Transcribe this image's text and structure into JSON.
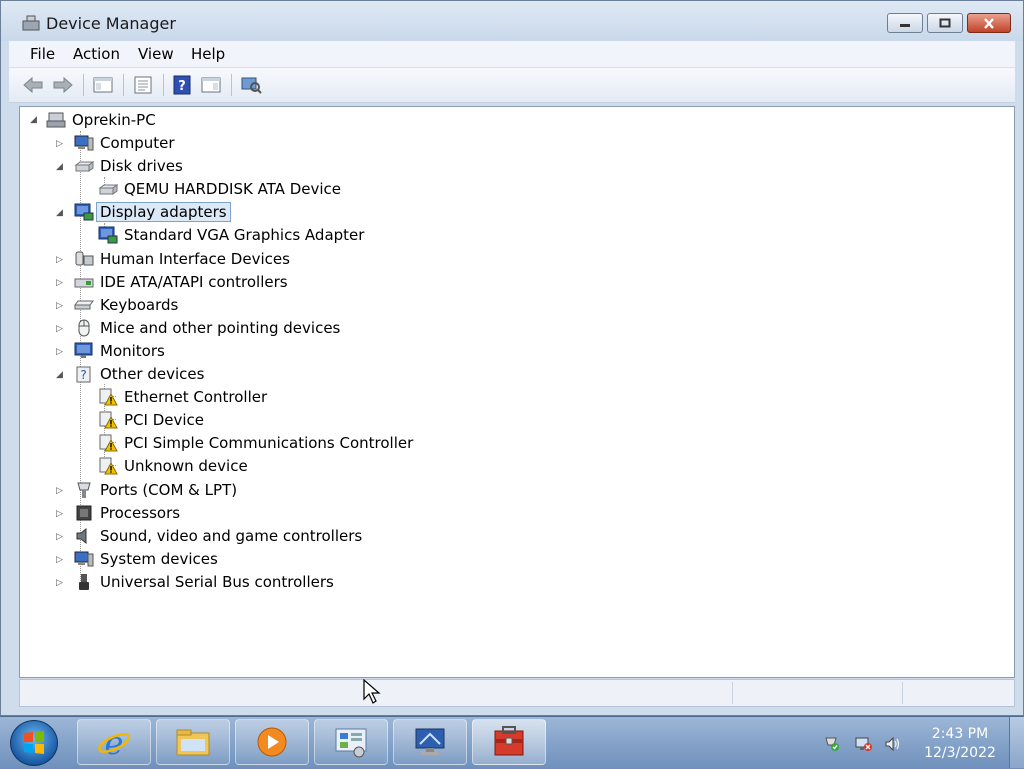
{
  "window": {
    "title": "Device Manager"
  },
  "menu": [
    "File",
    "Action",
    "View",
    "Help"
  ],
  "tree": {
    "root": "Oprekin-PC",
    "items": [
      {
        "label": "Computer",
        "icon": "computer-icon",
        "expander": "collapsed"
      },
      {
        "label": "Disk drives",
        "icon": "disk-drive-icon",
        "expander": "expanded"
      },
      {
        "label": "QEMU HARDDISK ATA Device",
        "icon": "disk-drive-icon",
        "child": true
      },
      {
        "label": "Display adapters",
        "icon": "display-adapter-icon",
        "expander": "expanded",
        "selected": true
      },
      {
        "label": "Standard VGA Graphics Adapter",
        "icon": "display-adapter-icon",
        "child": true
      },
      {
        "label": "Human Interface Devices",
        "icon": "hid-icon",
        "expander": "collapsed"
      },
      {
        "label": "IDE ATA/ATAPI controllers",
        "icon": "ide-controller-icon",
        "expander": "collapsed"
      },
      {
        "label": "Keyboards",
        "icon": "keyboard-icon",
        "expander": "collapsed"
      },
      {
        "label": "Mice and other pointing devices",
        "icon": "mouse-icon",
        "expander": "collapsed"
      },
      {
        "label": "Monitors",
        "icon": "monitor-icon",
        "expander": "collapsed"
      },
      {
        "label": "Other devices",
        "icon": "unknown-device-icon",
        "expander": "expanded"
      },
      {
        "label": "Ethernet Controller",
        "icon": "warning-device-icon",
        "child": true
      },
      {
        "label": "PCI Device",
        "icon": "warning-device-icon",
        "child": true
      },
      {
        "label": "PCI Simple Communications Controller",
        "icon": "warning-device-icon",
        "child": true
      },
      {
        "label": "Unknown device",
        "icon": "warning-device-icon",
        "child": true
      },
      {
        "label": "Ports (COM & LPT)",
        "icon": "port-icon",
        "expander": "collapsed"
      },
      {
        "label": "Processors",
        "icon": "processor-icon",
        "expander": "collapsed"
      },
      {
        "label": "Sound, video and game controllers",
        "icon": "speaker-icon",
        "expander": "collapsed"
      },
      {
        "label": "System devices",
        "icon": "computer-icon",
        "expander": "collapsed"
      },
      {
        "label": "Universal Serial Bus controllers",
        "icon": "usb-icon",
        "expander": "collapsed"
      }
    ]
  },
  "taskbar": {
    "apps": [
      "internet-explorer-icon",
      "windows-explorer-icon",
      "media-player-icon",
      "control-panel-icon",
      "remote-desktop-icon",
      "device-manager-icon"
    ],
    "tray": [
      "action-center-icon",
      "network-icon",
      "volume-icon"
    ],
    "clock": {
      "time": "2:43 PM",
      "date": "12/3/2022"
    }
  },
  "colors": {
    "selection_bg": "#dceaf8",
    "selection_border": "#7da2ce",
    "warning": "#f2c200"
  }
}
